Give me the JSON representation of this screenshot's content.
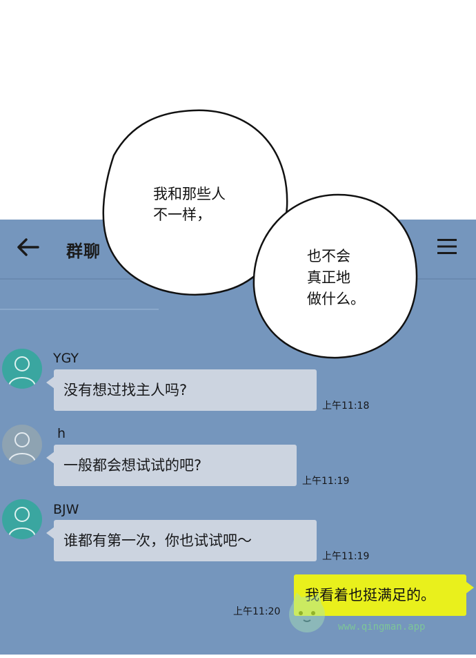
{
  "header": {
    "title": "群聊",
    "back_icon": "arrow-left-icon",
    "menu_icon": "hamburger-menu-icon"
  },
  "speech_bubbles": [
    {
      "lines": [
        "我和那些人",
        "不一样，"
      ]
    },
    {
      "lines": [
        "也不会",
        "真正地",
        "做什么。"
      ]
    }
  ],
  "messages": [
    {
      "sender": "YGY",
      "text": "没有想过找主人吗?",
      "time": "上午11:18"
    },
    {
      "sender": "h",
      "text": "一般都会想试试的吧?",
      "time": "上午11:19"
    },
    {
      "sender": "BJW",
      "text": "谁都有第一次，你也试试吧～",
      "time": "上午11:19"
    },
    {
      "sender": "",
      "text": "我看着也挺满足的。",
      "time": "上午11:20",
      "mine": true
    }
  ],
  "colors": {
    "chat_background": "#7596bd",
    "incoming_bubble": "#ccd4e0",
    "outgoing_bubble": "#e9f01c",
    "avatar_teal": "#3aa6a0"
  },
  "watermark": {
    "text": "www.qingman.app"
  }
}
